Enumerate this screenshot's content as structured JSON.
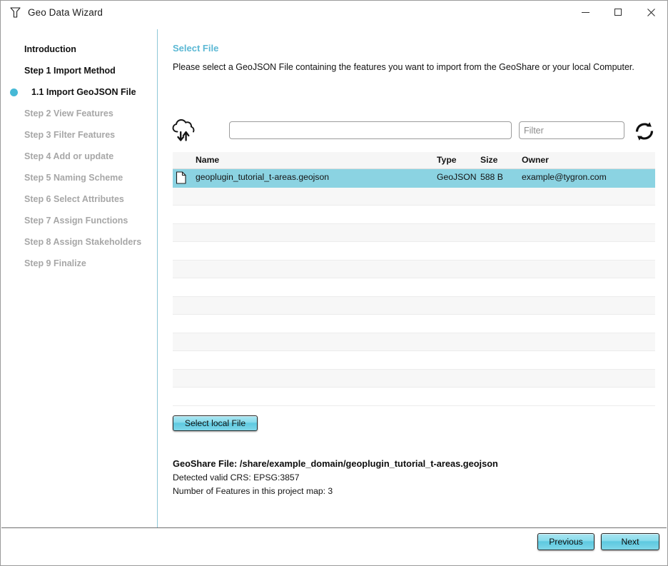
{
  "window": {
    "title": "Geo Data Wizard",
    "app_icon": "tygron-logo-icon",
    "controls": {
      "minimize": "minimize-icon",
      "maximize": "maximize-icon",
      "close": "close-icon"
    }
  },
  "sidebar": {
    "items": [
      {
        "label": "Introduction",
        "level": 0,
        "state": "visited",
        "bullet": false
      },
      {
        "label": "Step 1 Import Method",
        "level": 0,
        "state": "visited",
        "bullet": false
      },
      {
        "label": "1.1 Import GeoJSON File",
        "level": 1,
        "state": "current",
        "bullet": true
      },
      {
        "label": "Step 2 View Features",
        "level": 0,
        "state": "disabled",
        "bullet": false
      },
      {
        "label": "Step 3 Filter Features",
        "level": 0,
        "state": "disabled",
        "bullet": false
      },
      {
        "label": "Step 4 Add or update",
        "level": 0,
        "state": "disabled",
        "bullet": false
      },
      {
        "label": "Step 5 Naming Scheme",
        "level": 0,
        "state": "disabled",
        "bullet": false
      },
      {
        "label": "Step 6 Select Attributes",
        "level": 0,
        "state": "disabled",
        "bullet": false
      },
      {
        "label": "Step 7 Assign Functions",
        "level": 0,
        "state": "disabled",
        "bullet": false
      },
      {
        "label": "Step 8 Assign Stakeholders",
        "level": 0,
        "state": "disabled",
        "bullet": false
      },
      {
        "label": "Step 9 Finalize",
        "level": 0,
        "state": "disabled",
        "bullet": false
      }
    ]
  },
  "main": {
    "title": "Select File",
    "description": "Please select a GeoJSON File containing the features you want to import from the GeoShare or your local Computer.",
    "toolbar": {
      "cloud_icon": "cloud-transfer-icon",
      "search_value": "",
      "search_placeholder": "",
      "filter_value": "",
      "filter_placeholder": "Filter",
      "refresh_icon": "refresh-icon"
    },
    "table": {
      "columns": [
        "Name",
        "Type",
        "Size",
        "Owner"
      ],
      "rows": [
        {
          "name": "geoplugin_tutorial_t-areas.geojson",
          "type": "GeoJSON",
          "size": "588 B",
          "owner": "example@tygron.com",
          "selected": true,
          "icon": "file-document-icon"
        }
      ],
      "empty_row_count": 12
    },
    "select_local_file_label": "Select local File",
    "info": {
      "geoshare_label": "GeoShare File:",
      "geoshare_path": "/share/example_domain/geoplugin_tutorial_t-areas.geojson",
      "crs_line": "Detected valid CRS: EPSG:3857",
      "features_line": "Number of Features in this project map: 3"
    }
  },
  "footer": {
    "previous_label": "Previous",
    "next_label": "Next"
  },
  "colors": {
    "accent": "#5bb8d4",
    "selection": "#8bd3e2",
    "bullet": "#46b9d6",
    "divider": "#8ec8d8",
    "disabled_text": "#a7a7a7"
  }
}
